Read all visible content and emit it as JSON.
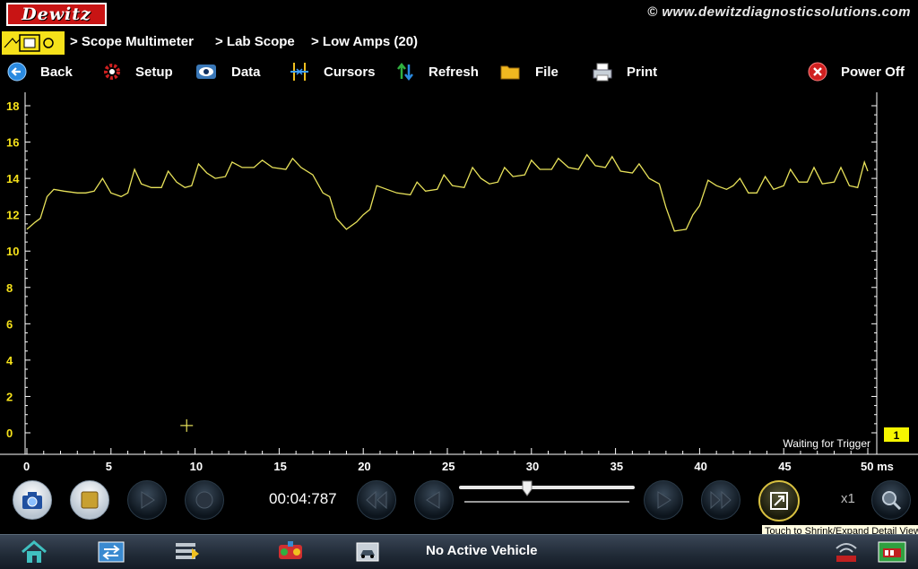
{
  "header": {
    "logo_text": "Dewitz",
    "website": "© www.dewitzdiagnosticsolutions.com",
    "breadcrumbs": [
      "> Scope Multimeter",
      "> Lab Scope",
      "> Low Amps (20)"
    ]
  },
  "toolbar": {
    "back": "Back",
    "setup": "Setup",
    "data": "Data",
    "cursors": "Cursors",
    "refresh": "Refresh",
    "file": "File",
    "print": "Print",
    "power_off": "Power Off"
  },
  "chart_data": {
    "type": "line",
    "ylim": [
      0,
      18
    ],
    "yticks": [
      "0",
      "2",
      "4",
      "6",
      "8",
      "10",
      "12",
      "14",
      "16",
      "18"
    ],
    "xlim": [
      0,
      50
    ],
    "xticks": [
      "0",
      "5",
      "10",
      "15",
      "20",
      "25",
      "30",
      "35",
      "40",
      "45",
      "50 ms"
    ],
    "line_color": "#e8e25a",
    "series": [
      {
        "values": [
          [
            0.0,
            11.2
          ],
          [
            0.5,
            11.6
          ],
          [
            0.8,
            11.8
          ],
          [
            1.2,
            13.0
          ],
          [
            1.6,
            13.4
          ],
          [
            2.2,
            13.3
          ],
          [
            3.0,
            13.2
          ],
          [
            3.5,
            13.2
          ],
          [
            4.0,
            13.3
          ],
          [
            4.5,
            14.0
          ],
          [
            5.0,
            13.2
          ],
          [
            5.6,
            13.0
          ],
          [
            6.0,
            13.2
          ],
          [
            6.4,
            14.5
          ],
          [
            6.8,
            13.7
          ],
          [
            7.4,
            13.5
          ],
          [
            8.0,
            13.5
          ],
          [
            8.4,
            14.4
          ],
          [
            8.9,
            13.8
          ],
          [
            9.4,
            13.5
          ],
          [
            9.8,
            13.6
          ],
          [
            10.2,
            14.8
          ],
          [
            10.7,
            14.3
          ],
          [
            11.2,
            14.0
          ],
          [
            11.8,
            14.1
          ],
          [
            12.2,
            14.9
          ],
          [
            12.8,
            14.6
          ],
          [
            13.5,
            14.6
          ],
          [
            14.0,
            15.0
          ],
          [
            14.6,
            14.6
          ],
          [
            15.4,
            14.5
          ],
          [
            15.8,
            15.1
          ],
          [
            16.3,
            14.6
          ],
          [
            17.0,
            14.2
          ],
          [
            17.6,
            13.2
          ],
          [
            18.0,
            13.0
          ],
          [
            18.4,
            11.8
          ],
          [
            19.0,
            11.2
          ],
          [
            19.6,
            11.6
          ],
          [
            20.0,
            12.0
          ],
          [
            20.4,
            12.3
          ],
          [
            20.8,
            13.6
          ],
          [
            21.4,
            13.4
          ],
          [
            22.0,
            13.2
          ],
          [
            22.8,
            13.1
          ],
          [
            23.2,
            13.8
          ],
          [
            23.7,
            13.3
          ],
          [
            24.4,
            13.4
          ],
          [
            24.8,
            14.2
          ],
          [
            25.3,
            13.6
          ],
          [
            26.0,
            13.5
          ],
          [
            26.5,
            14.6
          ],
          [
            27.0,
            14.0
          ],
          [
            27.5,
            13.7
          ],
          [
            28.0,
            13.8
          ],
          [
            28.4,
            14.6
          ],
          [
            28.9,
            14.1
          ],
          [
            29.6,
            14.2
          ],
          [
            30.0,
            15.0
          ],
          [
            30.5,
            14.5
          ],
          [
            31.2,
            14.5
          ],
          [
            31.6,
            15.1
          ],
          [
            32.2,
            14.6
          ],
          [
            32.8,
            14.5
          ],
          [
            33.3,
            15.3
          ],
          [
            33.8,
            14.7
          ],
          [
            34.4,
            14.6
          ],
          [
            34.8,
            15.2
          ],
          [
            35.3,
            14.4
          ],
          [
            36.0,
            14.3
          ],
          [
            36.4,
            14.8
          ],
          [
            37.0,
            14.0
          ],
          [
            37.6,
            13.7
          ],
          [
            38.0,
            12.4
          ],
          [
            38.5,
            11.1
          ],
          [
            39.2,
            11.2
          ],
          [
            39.6,
            12.0
          ],
          [
            40.0,
            12.5
          ],
          [
            40.5,
            13.9
          ],
          [
            41.0,
            13.6
          ],
          [
            41.6,
            13.4
          ],
          [
            42.0,
            13.6
          ],
          [
            42.4,
            14.0
          ],
          [
            42.9,
            13.2
          ],
          [
            43.4,
            13.2
          ],
          [
            43.9,
            14.1
          ],
          [
            44.4,
            13.4
          ],
          [
            45.0,
            13.6
          ],
          [
            45.4,
            14.5
          ],
          [
            45.9,
            13.8
          ],
          [
            46.4,
            13.8
          ],
          [
            46.8,
            14.6
          ],
          [
            47.3,
            13.7
          ],
          [
            48.0,
            13.8
          ],
          [
            48.4,
            14.6
          ],
          [
            48.9,
            13.6
          ],
          [
            49.4,
            13.5
          ],
          [
            49.8,
            14.9
          ],
          [
            50.0,
            14.4
          ]
        ]
      }
    ],
    "trigger_marker": [
      9.5,
      0.4
    ],
    "status_text": "Waiting for Trigger",
    "channel_badge": "1",
    "badge_color": "#f5f500"
  },
  "controls": {
    "time_readout": "00:04:787",
    "zoom": "x1",
    "tooltip": "Touch to Shrink/Expand Detail View",
    "slider_position": 0.38
  },
  "taskbar": {
    "vehicle_status": "No Active Vehicle"
  },
  "colors": {
    "accent_yellow": "#f5e11a",
    "trace": "#e8e25a",
    "logo_red": "#c81414"
  }
}
